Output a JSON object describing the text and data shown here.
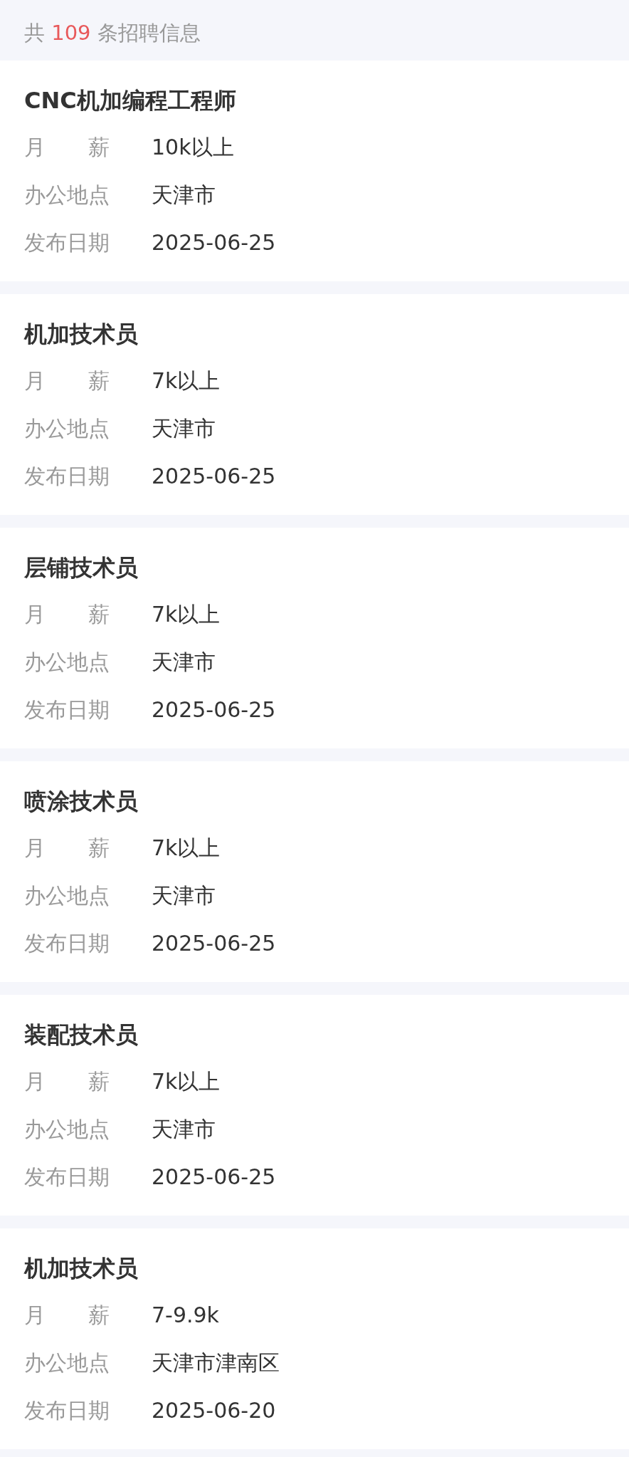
{
  "summary": {
    "prefix": "共",
    "count": "109",
    "suffix": "条招聘信息"
  },
  "jobs": [
    {
      "title": "CNC机加编程工程师",
      "fields": [
        {
          "label": "月　　薪",
          "value": "10k以上"
        },
        {
          "label": "办公地点",
          "value": "天津市"
        },
        {
          "label": "发布日期",
          "value": "2025-06-25"
        }
      ]
    },
    {
      "title": "机加技术员",
      "fields": [
        {
          "label": "月　　薪",
          "value": "7k以上"
        },
        {
          "label": "办公地点",
          "value": "天津市"
        },
        {
          "label": "发布日期",
          "value": "2025-06-25"
        }
      ]
    },
    {
      "title": "层铺技术员",
      "fields": [
        {
          "label": "月　　薪",
          "value": "7k以上"
        },
        {
          "label": "办公地点",
          "value": "天津市"
        },
        {
          "label": "发布日期",
          "value": "2025-06-25"
        }
      ]
    },
    {
      "title": "喷涂技术员",
      "fields": [
        {
          "label": "月　　薪",
          "value": "7k以上"
        },
        {
          "label": "办公地点",
          "value": "天津市"
        },
        {
          "label": "发布日期",
          "value": "2025-06-25"
        }
      ]
    },
    {
      "title": "装配技术员",
      "fields": [
        {
          "label": "月　　薪",
          "value": "7k以上"
        },
        {
          "label": "办公地点",
          "value": "天津市"
        },
        {
          "label": "发布日期",
          "value": "2025-06-25"
        }
      ]
    },
    {
      "title": "机加技术员",
      "fields": [
        {
          "label": "月　　薪",
          "value": "7-9.9k"
        },
        {
          "label": "办公地点",
          "value": "天津市津南区"
        },
        {
          "label": "发布日期",
          "value": "2025-06-20"
        }
      ]
    }
  ]
}
